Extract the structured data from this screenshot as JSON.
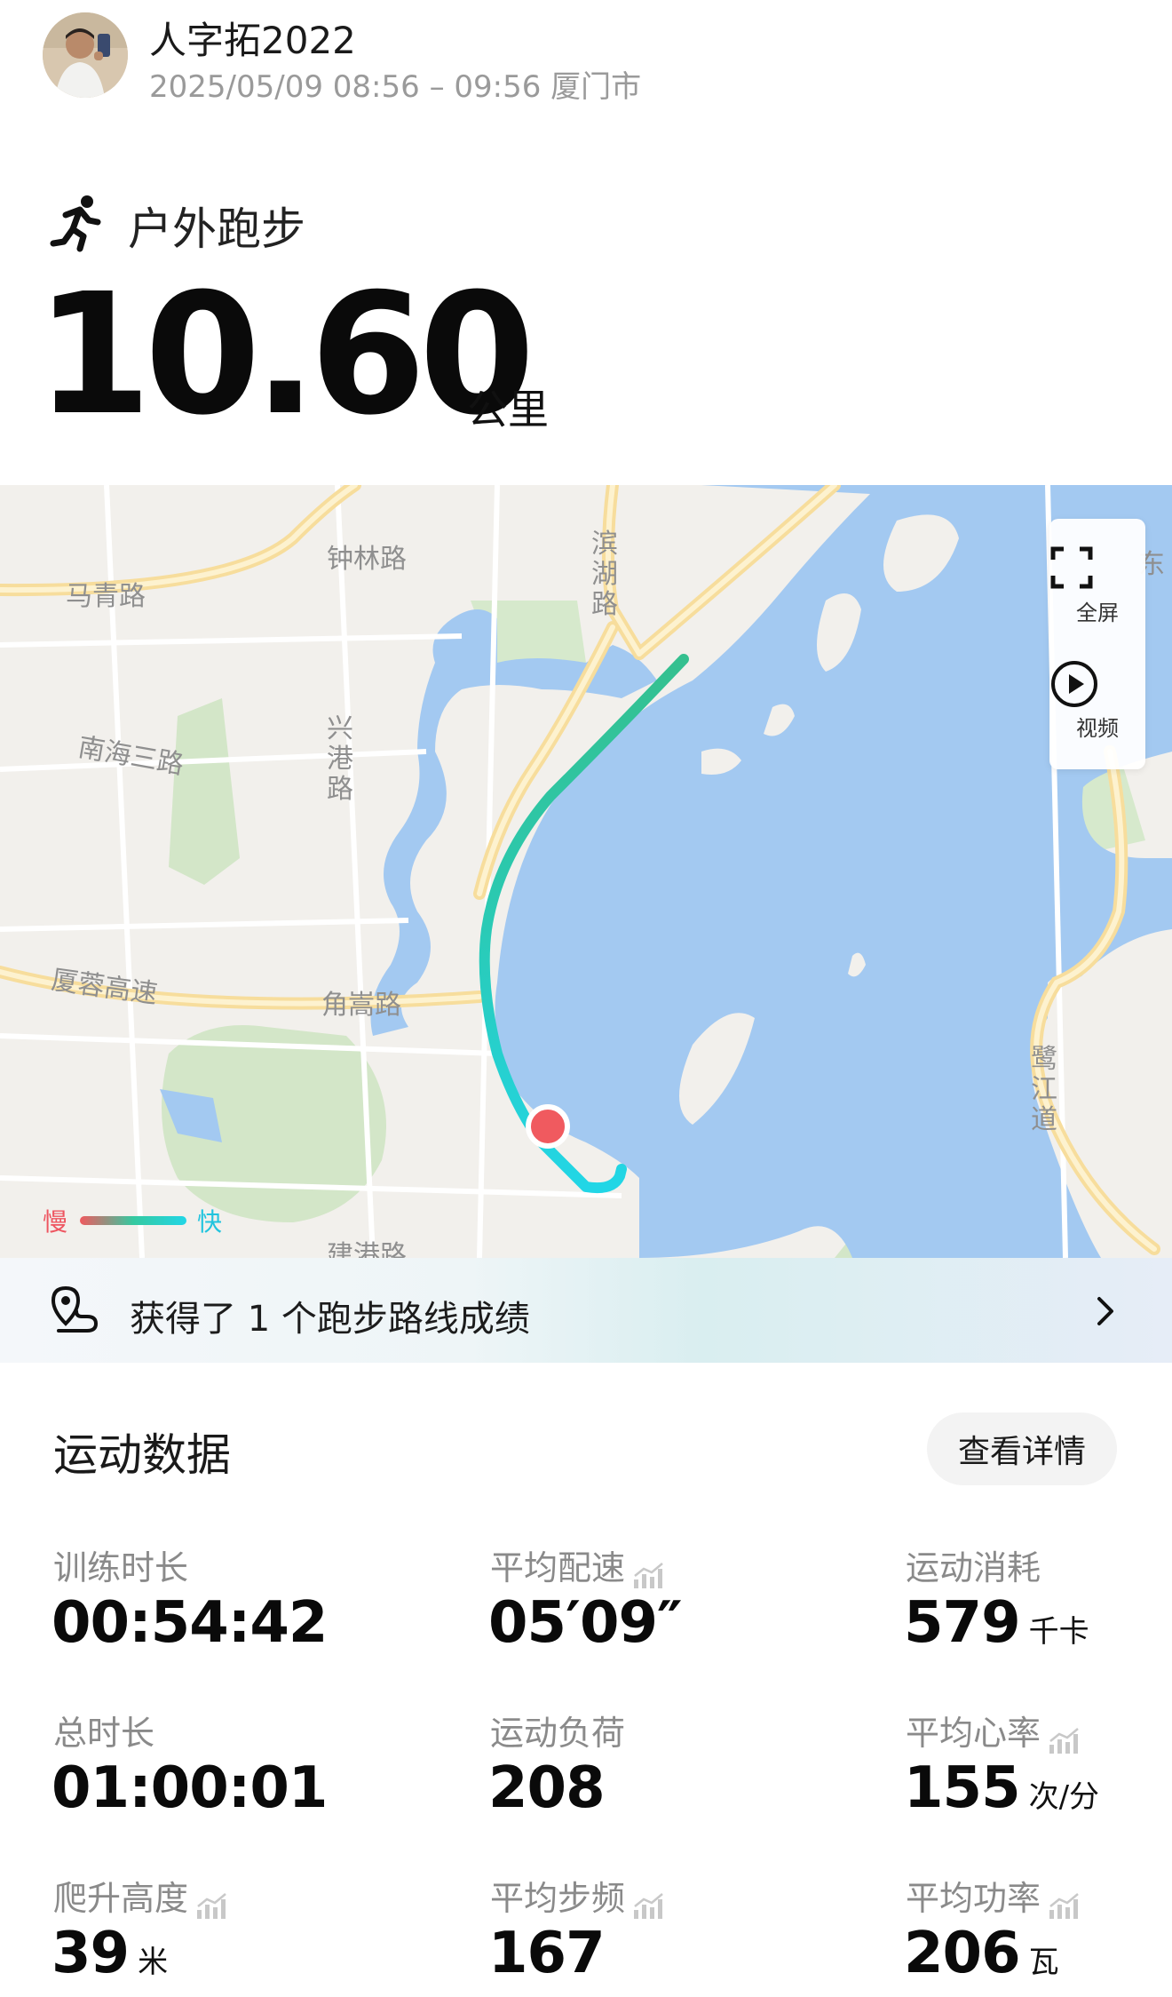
{
  "header": {
    "username": "人字拓2022",
    "meta": "2025/05/09 08:56 – 09:56 厦门市"
  },
  "activity": {
    "sport_name": "户外跑步",
    "distance": "10.60",
    "distance_unit": "公里"
  },
  "map": {
    "labels": {
      "zhonglin": "钟林路",
      "maqing": "马青路",
      "binhu": "滨湖路",
      "nanhai": "南海三路",
      "xinggang": "兴港路",
      "xiarong": "厦蓉高速",
      "jiaosong": "角嵩路",
      "lujiang": "鹭江道",
      "jiangang": "建港路",
      "dong": "东"
    },
    "controls": {
      "fullscreen": "全屏",
      "video": "视频"
    },
    "legend": {
      "slow": "慢",
      "fast": "快"
    },
    "colors": {
      "water": "#a3c9f1",
      "road": "#f9e3a6",
      "park": "#cfe3c3",
      "route_start": "#f05a5f",
      "route_end": "#22d6e6"
    }
  },
  "achievement": {
    "text": "获得了 1 个跑步路线成绩"
  },
  "stats": {
    "title": "运动数据",
    "details_button": "查看详情",
    "items": [
      {
        "label": "训练时长",
        "value": "00:54:42",
        "unit": ""
      },
      {
        "label": "平均配速",
        "value": "05′09″",
        "unit": ""
      },
      {
        "label": "运动消耗",
        "value": "579",
        "unit": "千卡"
      },
      {
        "label": "总时长",
        "value": "01:00:01",
        "unit": ""
      },
      {
        "label": "运动负荷",
        "value": "208",
        "unit": ""
      },
      {
        "label": "平均心率",
        "value": "155",
        "unit": "次/分"
      },
      {
        "label": "爬升高度",
        "value": "39",
        "unit": "米"
      },
      {
        "label": "平均步频",
        "value": "167",
        "unit": ""
      },
      {
        "label": "平均功率",
        "value": "206",
        "unit": "瓦"
      }
    ]
  }
}
